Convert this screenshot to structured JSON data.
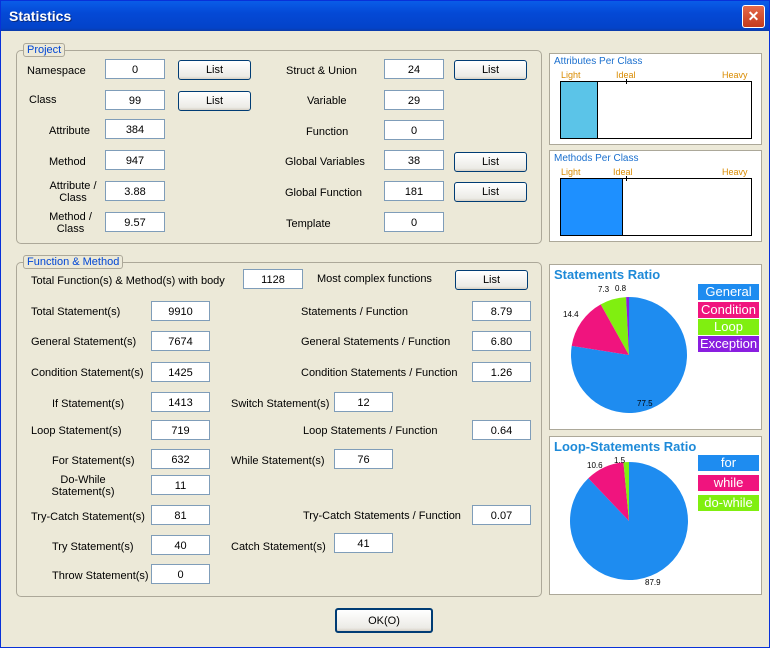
{
  "window": {
    "title": "Statistics"
  },
  "project": {
    "legend": "Project",
    "namespace": {
      "label": "Namespace",
      "value": "0",
      "button": "List"
    },
    "class": {
      "label": "Class",
      "value": "99",
      "button": "List"
    },
    "attribute": {
      "label": "Attribute",
      "value": "384"
    },
    "method": {
      "label": "Method",
      "value": "947"
    },
    "attr_per_class": {
      "label": "Attribute / Class",
      "value": "3.88"
    },
    "method_per_class": {
      "label": "Method / Class",
      "value": "9.57"
    },
    "struct_union": {
      "label": "Struct & Union",
      "value": "24",
      "button": "List"
    },
    "variable": {
      "label": "Variable",
      "value": "29"
    },
    "function": {
      "label": "Function",
      "value": "0"
    },
    "global_variables": {
      "label": "Global Variables",
      "value": "38",
      "button": "List"
    },
    "global_function": {
      "label": "Global Function",
      "value": "181",
      "button": "List"
    },
    "template": {
      "label": "Template",
      "value": "0"
    }
  },
  "func": {
    "legend": "Function & Method",
    "total_with_body": {
      "label": "Total Function(s) & Method(s) with body",
      "value": "1128"
    },
    "most_complex": {
      "label": "Most complex functions",
      "button": "List"
    },
    "total_stmt": {
      "label": "Total Statement(s)",
      "value": "9910"
    },
    "general_stmt": {
      "label": "General Statement(s)",
      "value": "7674"
    },
    "condition_stmt": {
      "label": "Condition Statement(s)",
      "value": "1425"
    },
    "if_stmt": {
      "label": "If Statement(s)",
      "value": "1413"
    },
    "loop_stmt": {
      "label": "Loop Statement(s)",
      "value": "719"
    },
    "for_stmt": {
      "label": "For Statement(s)",
      "value": "632"
    },
    "dowhile_stmt": {
      "label": "Do-While Statement(s)",
      "value": "11"
    },
    "trycatch_stmt": {
      "label": "Try-Catch Statement(s)",
      "value": "81"
    },
    "try_stmt": {
      "label": "Try Statement(s)",
      "value": "40"
    },
    "throw_stmt": {
      "label": "Throw Statement(s)",
      "value": "0"
    },
    "switch_stmt": {
      "label": "Switch Statement(s)",
      "value": "12"
    },
    "while_stmt": {
      "label": "While Statement(s)",
      "value": "76"
    },
    "catch_stmt": {
      "label": "Catch Statement(s)",
      "value": "41"
    },
    "stmt_per_func": {
      "label": "Statements / Function",
      "value": "8.79"
    },
    "general_per_func": {
      "label": "General Statements / Function",
      "value": "6.80"
    },
    "condition_per_func": {
      "label": "Condition Statements / Function",
      "value": "1.26"
    },
    "loop_per_func": {
      "label": "Loop Statements / Function",
      "value": "0.64"
    },
    "trycatch_per_func": {
      "label": "Try-Catch Statements / Function",
      "value": "0.07"
    }
  },
  "attr_panel": {
    "title": "Attributes Per Class",
    "light": "Light",
    "ideal": "Ideal",
    "heavy": "Heavy",
    "fill": 0.19,
    "ideal_pos": 0.34,
    "color": "#5bc4e8"
  },
  "meth_panel": {
    "title": "Methods Per Class",
    "light": "Light",
    "ideal": "Ideal",
    "heavy": "Heavy",
    "fill": 0.32,
    "ideal_pos": 0.34,
    "color": "#1e90ff"
  },
  "statements_ratio": {
    "title": "Statements Ratio",
    "legend": [
      "General",
      "Condition",
      "Loop",
      "Exception"
    ],
    "labels": [
      "77.5",
      "14.4",
      "7.3",
      "0.8"
    ],
    "values": [
      77.5,
      14.4,
      7.3,
      0.8
    ],
    "colors": [
      "#1e8cf0",
      "#f0147e",
      "#80ef10",
      "#8a1ee0"
    ]
  },
  "loop_ratio": {
    "title": "Loop-Statements Ratio",
    "legend": [
      "for",
      "while",
      "do-while"
    ],
    "labels": [
      "87.9",
      "10.6",
      "1.5"
    ],
    "values": [
      87.9,
      10.6,
      1.5
    ],
    "colors": [
      "#1e8cf0",
      "#f0147e",
      "#80ef10"
    ]
  },
  "ok_button": "OK(O)"
}
